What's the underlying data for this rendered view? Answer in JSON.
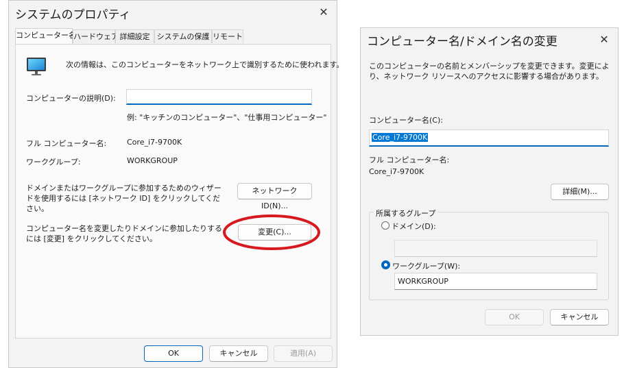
{
  "sysprops": {
    "title": "システムのプロパティ",
    "tabs": [
      "コンピューター名",
      "ハードウェア",
      "詳細設定",
      "システムの保護",
      "リモート"
    ],
    "info_text": "次の情報は、このコンピューターをネットワーク上で識別するために使われます。",
    "description_label": "コンピューターの説明(D):",
    "description_value": "",
    "example_text": "例: \"キッチンのコンピューター\"、\"仕事用コンピューター\"",
    "full_name_label": "フル コンピューター名:",
    "full_name_value": "Core_i7-9700K",
    "workgroup_label": "ワークグループ:",
    "workgroup_value": "WORKGROUP",
    "network_text": "ドメインまたはワークグループに参加するためのウィザードを使用するには [ネットワーク ID] をクリックしてください。",
    "network_button": "ネットワーク ID(N)...",
    "change_text": "コンピューター名を変更したりドメインに参加したりするには [変更] をクリックしてください。",
    "change_button": "変更(C)...",
    "ok_button": "OK",
    "cancel_button": "キャンセル",
    "apply_button": "適用(A)"
  },
  "rename": {
    "title": "コンピューター名/ドメイン名の変更",
    "description": "このコンピューターの名前とメンバーシップを変更できます。変更により、ネットワーク リソースへのアクセスに影響する場合があります。",
    "computer_name_label": "コンピューター名(C):",
    "computer_name_value": "Core_i7-9700K",
    "full_name_label": "フル コンピューター名:",
    "full_name_value": "Core_i7-9700K",
    "details_button": "詳細(M)...",
    "member_group_label": "所属するグループ",
    "domain_label": "ドメイン(D):",
    "domain_value": "",
    "workgroup_label": "ワークグループ(W):",
    "workgroup_value": "WORKGROUP",
    "ok_button": "OK",
    "cancel_button": "キャンセル"
  },
  "colors": {
    "accent": "#0067c0",
    "highlight_circle": "#d7191f",
    "selection_bg": "#0078d4"
  },
  "icons": {
    "computer": "monitor-icon",
    "close": "close-icon"
  }
}
